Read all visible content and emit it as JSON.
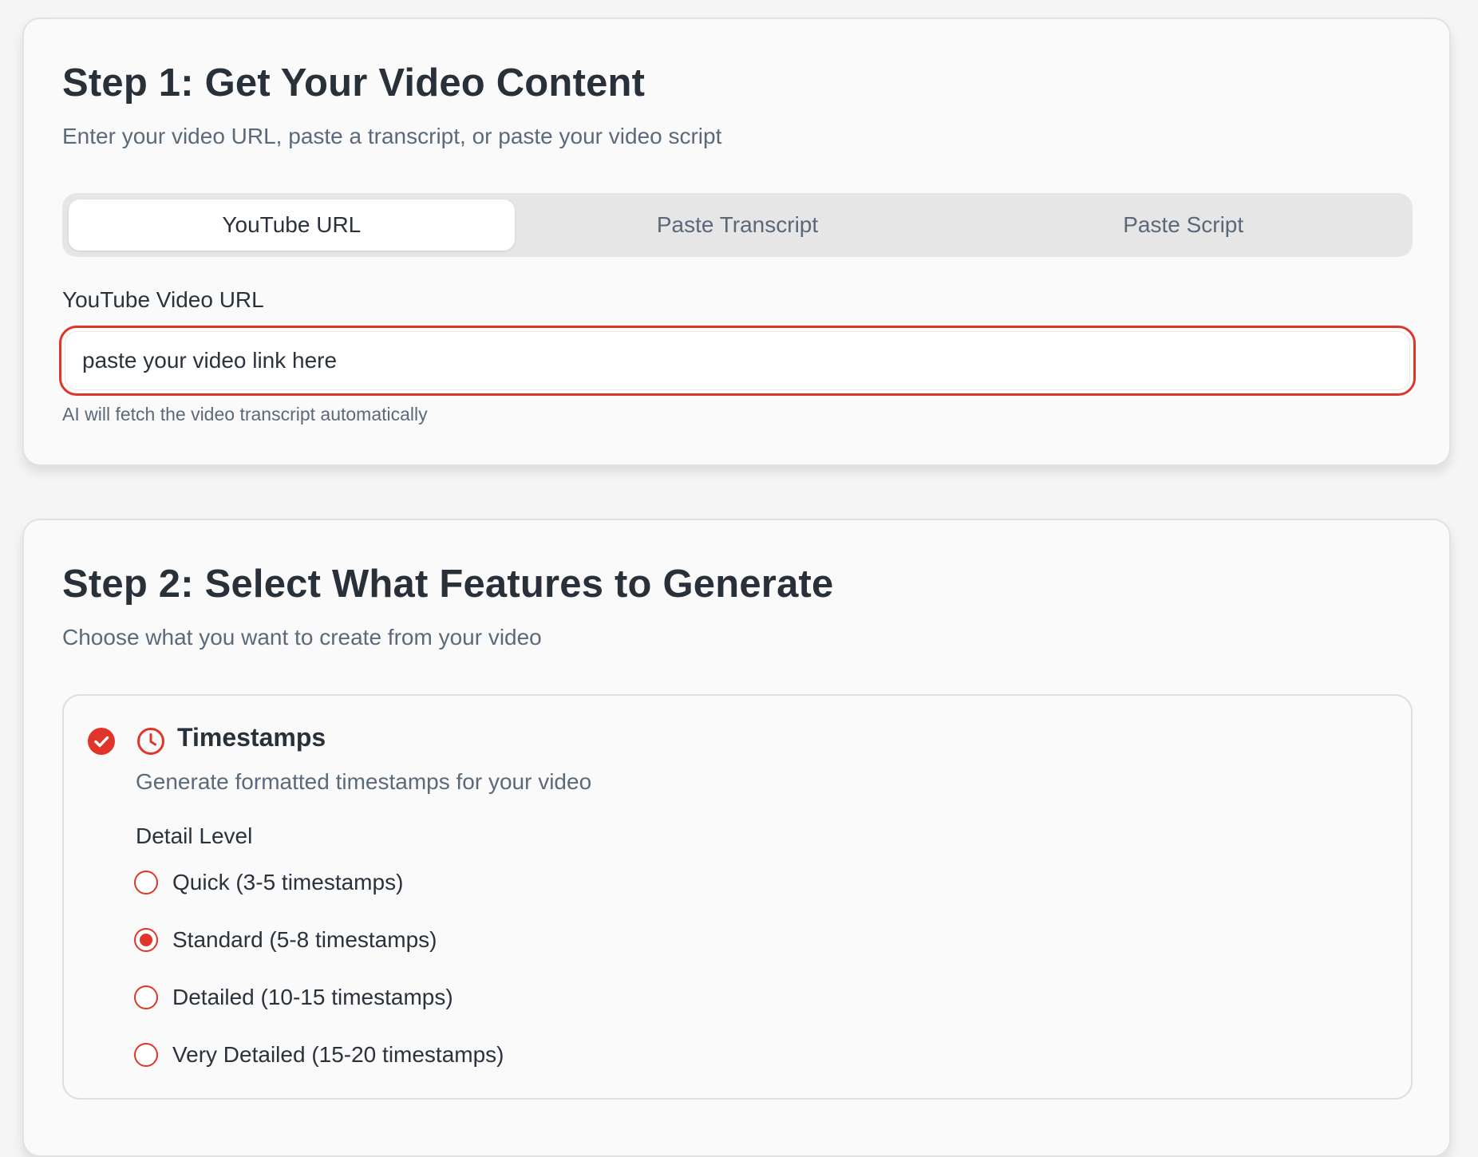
{
  "colors": {
    "accent": "#e0352b",
    "heading": "#28303a",
    "muted": "#5b6a7b",
    "tab_bg": "#e6e6e6"
  },
  "step1": {
    "title": "Step 1: Get Your Video Content",
    "subtitle": "Enter your video URL, paste a transcript, or paste your video script",
    "tabs": [
      {
        "label": "YouTube URL",
        "active": true
      },
      {
        "label": "Paste Transcript",
        "active": false
      },
      {
        "label": "Paste Script",
        "active": false
      }
    ],
    "url_field": {
      "label": "YouTube Video URL",
      "value": "",
      "placeholder": "paste your video link here",
      "hint": "AI will fetch the video transcript automatically"
    }
  },
  "step2": {
    "title": "Step 2: Select What Features to Generate",
    "subtitle": "Choose what you want to create from your video",
    "feature": {
      "checked": true,
      "icon": "clock-icon",
      "title": "Timestamps",
      "description": "Generate formatted timestamps for your video",
      "detail_label": "Detail Level",
      "options": [
        {
          "label": "Quick (3-5 timestamps)",
          "selected": false
        },
        {
          "label": "Standard (5-8 timestamps)",
          "selected": true
        },
        {
          "label": "Detailed (10-15 timestamps)",
          "selected": false
        },
        {
          "label": "Very Detailed (15-20 timestamps)",
          "selected": false
        }
      ]
    }
  }
}
